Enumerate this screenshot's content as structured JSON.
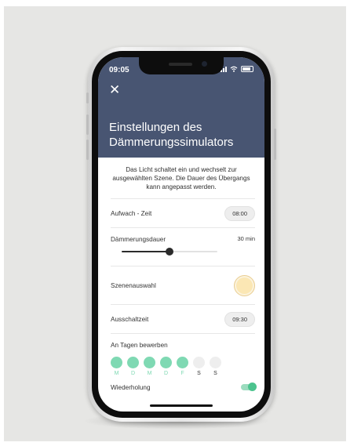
{
  "status_bar": {
    "time": "09:05"
  },
  "header": {
    "close_glyph": "✕",
    "title": "Einstellungen des Dämmerungssimulators"
  },
  "intro": "Das Licht schaltet ein und wechselt zur ausgewählten Szene. Die Dauer des Übergangs kann angepasst werden.",
  "wake_time": {
    "label": "Aufwach - Zeit",
    "value": "08:00"
  },
  "dawn_duration": {
    "label": "Dämmerungsdauer",
    "value": "30 min",
    "slider_fraction": 0.5
  },
  "scene": {
    "label": "Szenenauswahl",
    "color": "#fbe7b4"
  },
  "off_time": {
    "label": "Ausschaltzeit",
    "value": "09:30"
  },
  "days": {
    "label": "An Tagen bewerben",
    "items": [
      {
        "letter": "M",
        "active": true
      },
      {
        "letter": "D",
        "active": true
      },
      {
        "letter": "M",
        "active": true
      },
      {
        "letter": "D",
        "active": true
      },
      {
        "letter": "F",
        "active": true
      },
      {
        "letter": "S",
        "active": false
      },
      {
        "letter": "S",
        "active": false
      }
    ]
  },
  "repeat": {
    "label": "Wiederholung",
    "on": true
  },
  "colors": {
    "header": "#485572",
    "accent_green": "#7fd9b3",
    "toggle_green": "#4cc38e",
    "inactive_dot": "#eeeeee"
  }
}
